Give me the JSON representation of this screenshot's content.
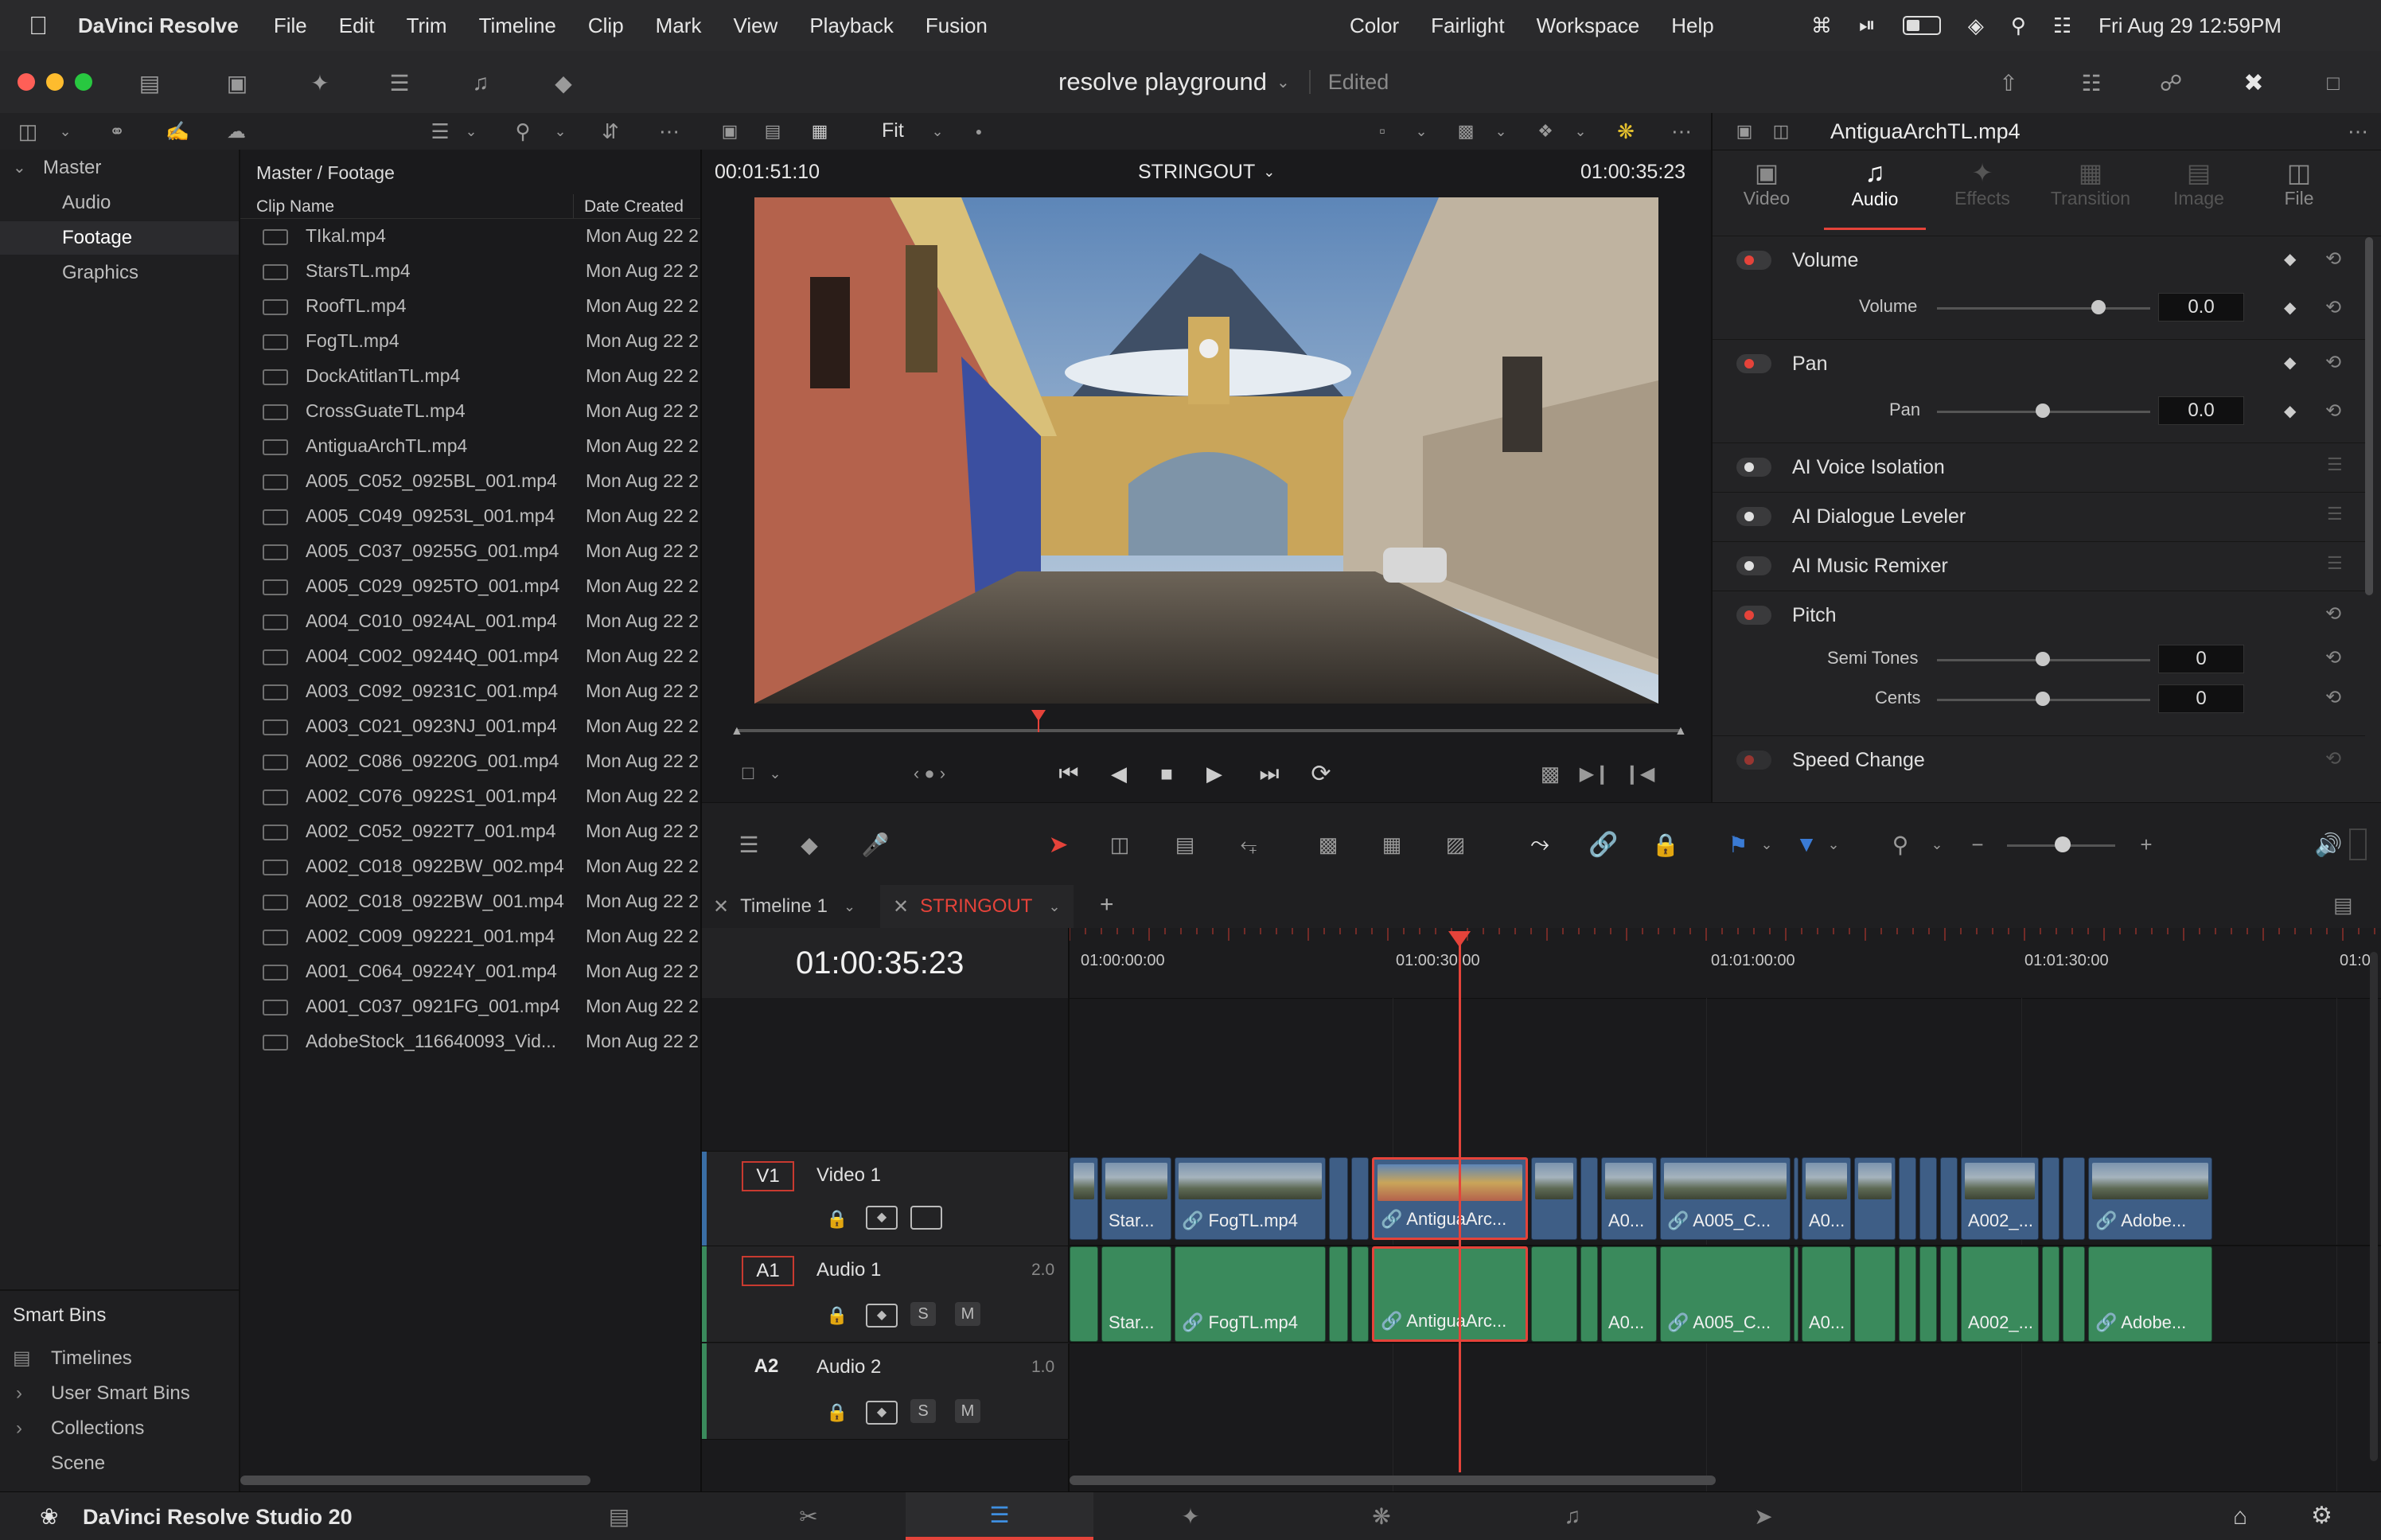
{
  "menubar": {
    "app_name": "DaVinci Resolve",
    "items": [
      "File",
      "Edit",
      "Trim",
      "Timeline",
      "Clip",
      "Mark",
      "View",
      "Playback",
      "Fusion"
    ],
    "right_items": [
      "Color",
      "Fairlight",
      "Workspace",
      "Help"
    ],
    "clock": "Fri Aug 29  12:59PM"
  },
  "window": {
    "project_title": "resolve playground",
    "status": "Edited"
  },
  "sidebar": {
    "master": "Master",
    "bins": [
      "Audio",
      "Footage",
      "Graphics"
    ],
    "selected": "Footage",
    "smart_bins_title": "Smart Bins",
    "smart_bins": [
      "Timelines",
      "User Smart Bins",
      "Collections",
      "Scene"
    ]
  },
  "media_pool": {
    "breadcrumb": "Master / Footage",
    "col_clip_name": "Clip Name",
    "col_date": "Date Created",
    "clips": [
      {
        "name": "TIkal.mp4",
        "date": "Mon Aug 22 2"
      },
      {
        "name": "StarsTL.mp4",
        "date": "Mon Aug 22 2"
      },
      {
        "name": "RoofTL.mp4",
        "date": "Mon Aug 22 2"
      },
      {
        "name": "FogTL.mp4",
        "date": "Mon Aug 22 2"
      },
      {
        "name": "DockAtitlanTL.mp4",
        "date": "Mon Aug 22 2"
      },
      {
        "name": "CrossGuateTL.mp4",
        "date": "Mon Aug 22 2"
      },
      {
        "name": "AntiguaArchTL.mp4",
        "date": "Mon Aug 22 2"
      },
      {
        "name": "A005_C052_0925BL_001.mp4",
        "date": "Mon Aug 22 2"
      },
      {
        "name": "A005_C049_09253L_001.mp4",
        "date": "Mon Aug 22 2"
      },
      {
        "name": "A005_C037_09255G_001.mp4",
        "date": "Mon Aug 22 2"
      },
      {
        "name": "A005_C029_0925TO_001.mp4",
        "date": "Mon Aug 22 2"
      },
      {
        "name": "A004_C010_0924AL_001.mp4",
        "date": "Mon Aug 22 2"
      },
      {
        "name": "A004_C002_09244Q_001.mp4",
        "date": "Mon Aug 22 2"
      },
      {
        "name": "A003_C092_09231C_001.mp4",
        "date": "Mon Aug 22 2"
      },
      {
        "name": "A003_C021_0923NJ_001.mp4",
        "date": "Mon Aug 22 2"
      },
      {
        "name": "A002_C086_09220G_001.mp4",
        "date": "Mon Aug 22 2"
      },
      {
        "name": "A002_C076_0922S1_001.mp4",
        "date": "Mon Aug 22 2"
      },
      {
        "name": "A002_C052_0922T7_001.mp4",
        "date": "Mon Aug 22 2"
      },
      {
        "name": "A002_C018_0922BW_002.mp4",
        "date": "Mon Aug 22 2"
      },
      {
        "name": "A002_C018_0922BW_001.mp4",
        "date": "Mon Aug 22 2"
      },
      {
        "name": "A002_C009_092221_001.mp4",
        "date": "Mon Aug 22 2"
      },
      {
        "name": "A001_C064_09224Y_001.mp4",
        "date": "Mon Aug 22 2"
      },
      {
        "name": "A001_C037_0921FG_001.mp4",
        "date": "Mon Aug 22 2"
      },
      {
        "name": "AdobeStock_116640093_Vid...",
        "date": "Mon Aug 22 2"
      }
    ]
  },
  "viewer": {
    "zoom": "Fit",
    "source_tc": "00:01:51:10",
    "timeline_name": "STRINGOUT",
    "record_tc": "01:00:35:23",
    "playhead_fraction": 0.32
  },
  "inspector": {
    "clip_name": "AntiguaArchTL.mp4",
    "tabs": [
      "Video",
      "Audio",
      "Effects",
      "Transition",
      "Image",
      "File"
    ],
    "active_tab": "Audio",
    "volume": {
      "section": "Volume",
      "label": "Volume",
      "value": "0.0"
    },
    "pan": {
      "section": "Pan",
      "label": "Pan",
      "value": "0.0"
    },
    "ai_voice": "AI Voice Isolation",
    "ai_dialogue": "AI Dialogue Leveler",
    "ai_music": "AI Music Remixer",
    "pitch": {
      "section": "Pitch",
      "semitones_label": "Semi Tones",
      "semitones": "0",
      "cents_label": "Cents",
      "cents": "0"
    },
    "speed_change": "Speed Change"
  },
  "timeline": {
    "tabs": [
      {
        "label": "Timeline 1"
      },
      {
        "label": "STRINGOUT"
      }
    ],
    "active_tab": "STRINGOUT",
    "timecode": "01:00:35:23",
    "ruler": [
      "01:00:00:00",
      "01:00:30:00",
      "01:01:00:00",
      "01:01:30:00",
      "01:0"
    ],
    "tracks": {
      "v1": {
        "id": "V1",
        "name": "Video 1"
      },
      "a1": {
        "id": "A1",
        "name": "Audio 1",
        "level": "2.0"
      },
      "a2": {
        "id": "A2",
        "name": "Audio 2",
        "level": "1.0"
      }
    },
    "clip_labels": {
      "stars": "Star...",
      "fog": "FogTL.mp4",
      "antigua": "AntiguaArc...",
      "a0a": "A0...",
      "a005": "A005_C...",
      "a0b": "A0...",
      "a002": "A002_...",
      "adobe": "Adobe..."
    }
  },
  "bottombar": {
    "product": "DaVinci Resolve Studio 20"
  },
  "colors": {
    "accent": "#e5433a",
    "video_clip": "#3e5e86",
    "audio_clip": "#3a8a5c"
  }
}
